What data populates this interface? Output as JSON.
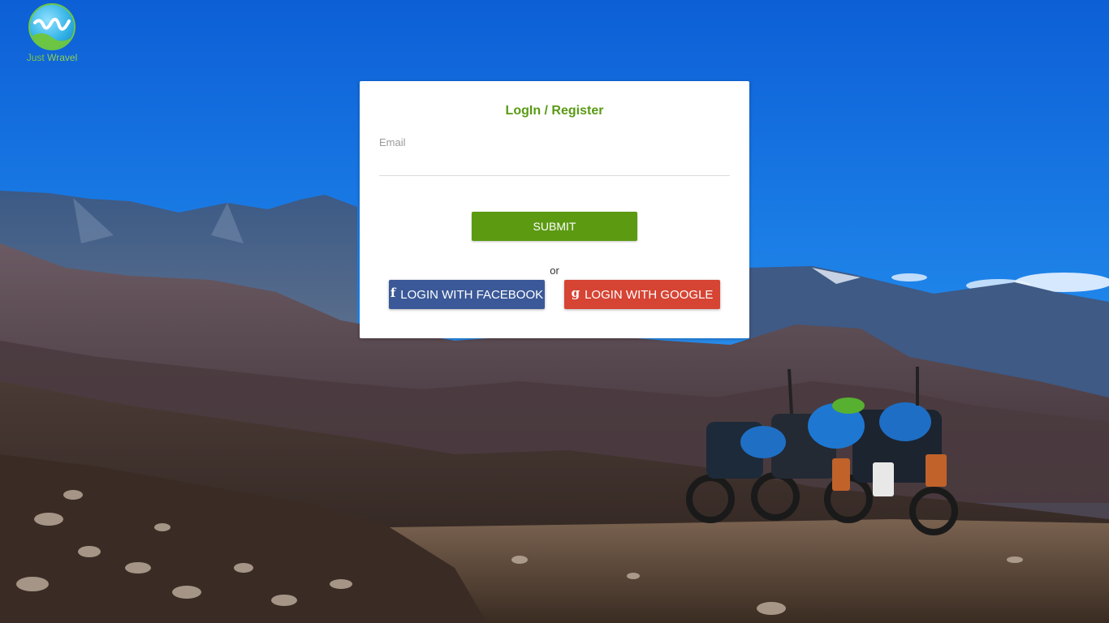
{
  "brand": {
    "name_part1": "Just",
    "name_part2": "Wravel",
    "logo_icon": "wave-w-icon",
    "colors": {
      "green": "#6cc644",
      "blue": "#33b3e6"
    }
  },
  "login_card": {
    "title": "LogIn / Register",
    "email_label": "Email",
    "email_value": "",
    "submit_label": "SUBMIT",
    "divider_text": "or",
    "facebook": {
      "icon": "facebook-icon",
      "glyph": "f",
      "label": "LOGIN WITH FACEBOOK",
      "color": "#3b5998"
    },
    "google": {
      "icon": "google-icon",
      "glyph": "g",
      "label": "LOGIN WITH GOOGLE",
      "color": "#d64434"
    },
    "accent_color": "#5c9a12"
  },
  "background": {
    "description_icon": "mountain-landscape-photo"
  }
}
